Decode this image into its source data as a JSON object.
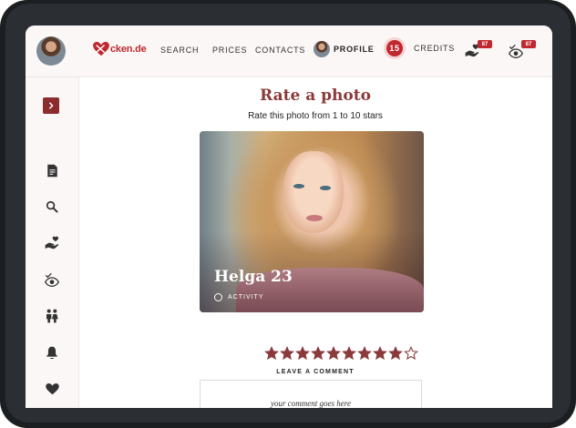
{
  "brand": {
    "name": "cken.de",
    "accent": "#c0282f",
    "title_color": "#8b3a3c"
  },
  "nav": {
    "search": "SEARCH",
    "prices": "PRICES",
    "contacts": "CONTACTS",
    "profile": "PROFILE"
  },
  "credits": {
    "count": "15",
    "label": "CREDITS"
  },
  "badges": {
    "likes": "87",
    "views": "87"
  },
  "sidebar": {
    "items": [
      {
        "icon": "chevron-right-icon"
      },
      {
        "icon": "document-icon"
      },
      {
        "icon": "search-icon"
      },
      {
        "icon": "hand-heart-icon"
      },
      {
        "icon": "eye-check-icon"
      },
      {
        "icon": "couple-icon"
      },
      {
        "icon": "bell-icon"
      },
      {
        "icon": "heart-icon"
      }
    ]
  },
  "main": {
    "title": "Rate a photo",
    "subtitle": "Rate this photo from 1 to 10 stars",
    "photo": {
      "name": "Helga 23",
      "activity": "ACTIVITY"
    },
    "rating": {
      "filled": 9,
      "total": 10
    },
    "comment": {
      "label": "LEAVE A COMMENT",
      "placeholder": "your comment goes here",
      "value": ""
    }
  }
}
